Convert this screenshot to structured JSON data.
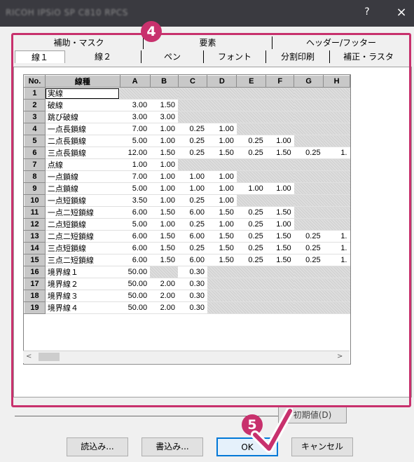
{
  "window": {
    "title": "RICOH IPSiO SP C810 RPCS",
    "help": "?",
    "close": "×"
  },
  "tabs_top": [
    {
      "label": "補助・マスク"
    },
    {
      "label": "要素"
    },
    {
      "label": "ヘッダー/フッター"
    }
  ],
  "tabs_bottom": [
    {
      "label": "線１"
    },
    {
      "label": "線２"
    },
    {
      "label": "ペン"
    },
    {
      "label": "フォント"
    },
    {
      "label": "分割印刷"
    },
    {
      "label": "補正・ラスタ"
    }
  ],
  "table": {
    "columns": [
      "No.",
      "線種",
      "A",
      "B",
      "C",
      "D",
      "E",
      "F",
      "G",
      "H"
    ],
    "rows": [
      {
        "no": "1",
        "name": "実線",
        "v": [
          "",
          "",
          "",
          "",
          "",
          "",
          "",
          ""
        ]
      },
      {
        "no": "2",
        "name": "破線",
        "v": [
          "3.00",
          "1.50",
          "",
          "",
          "",
          "",
          "",
          ""
        ]
      },
      {
        "no": "3",
        "name": "跳び破線",
        "v": [
          "3.00",
          "3.00",
          "",
          "",
          "",
          "",
          "",
          ""
        ]
      },
      {
        "no": "4",
        "name": "一点長鎖線",
        "v": [
          "7.00",
          "1.00",
          "0.25",
          "1.00",
          "",
          "",
          "",
          ""
        ]
      },
      {
        "no": "5",
        "name": "二点長鎖線",
        "v": [
          "5.00",
          "1.00",
          "0.25",
          "1.00",
          "0.25",
          "1.00",
          "",
          ""
        ]
      },
      {
        "no": "6",
        "name": "三点長鎖線",
        "v": [
          "12.00",
          "1.50",
          "0.25",
          "1.50",
          "0.25",
          "1.50",
          "0.25",
          "1."
        ]
      },
      {
        "no": "7",
        "name": "点線",
        "v": [
          "1.00",
          "1.00",
          "",
          "",
          "",
          "",
          "",
          ""
        ]
      },
      {
        "no": "8",
        "name": "一点鎖線",
        "v": [
          "7.00",
          "1.00",
          "1.00",
          "1.00",
          "",
          "",
          "",
          ""
        ]
      },
      {
        "no": "9",
        "name": "二点鎖線",
        "v": [
          "5.00",
          "1.00",
          "1.00",
          "1.00",
          "1.00",
          "1.00",
          "",
          ""
        ]
      },
      {
        "no": "10",
        "name": "一点短鎖線",
        "v": [
          "3.50",
          "1.00",
          "0.25",
          "1.00",
          "",
          "",
          "",
          ""
        ]
      },
      {
        "no": "11",
        "name": "一点二短鎖線",
        "v": [
          "6.00",
          "1.50",
          "6.00",
          "1.50",
          "0.25",
          "1.50",
          "",
          ""
        ]
      },
      {
        "no": "12",
        "name": "二点短鎖線",
        "v": [
          "5.00",
          "1.00",
          "0.25",
          "1.00",
          "0.25",
          "1.00",
          "",
          ""
        ]
      },
      {
        "no": "13",
        "name": "二点二短鎖線",
        "v": [
          "6.00",
          "1.50",
          "6.00",
          "1.50",
          "0.25",
          "1.50",
          "0.25",
          "1."
        ]
      },
      {
        "no": "14",
        "name": "三点短鎖線",
        "v": [
          "6.00",
          "1.50",
          "0.25",
          "1.50",
          "0.25",
          "1.50",
          "0.25",
          "1."
        ]
      },
      {
        "no": "15",
        "name": "三点二短鎖線",
        "v": [
          "6.00",
          "1.50",
          "6.00",
          "1.50",
          "0.25",
          "1.50",
          "0.25",
          "1."
        ]
      },
      {
        "no": "16",
        "name": "境界線１",
        "v": [
          "50.00",
          "",
          "0.30",
          "",
          "",
          "",
          "",
          ""
        ]
      },
      {
        "no": "17",
        "name": "境界線２",
        "v": [
          "50.00",
          "2.00",
          "0.30",
          "",
          "",
          "",
          "",
          ""
        ]
      },
      {
        "no": "18",
        "name": "境界線３",
        "v": [
          "50.00",
          "2.00",
          "0.30",
          "",
          "",
          "",
          "",
          ""
        ]
      },
      {
        "no": "19",
        "name": "境界線４",
        "v": [
          "50.00",
          "2.00",
          "0.30",
          "",
          "",
          "",
          "",
          ""
        ]
      }
    ]
  },
  "scroll": {
    "left": "<",
    "right": ">"
  },
  "hidden_button": "初期値(D)",
  "buttons": {
    "load": "読込み...",
    "save": "書込み...",
    "ok": "OK",
    "cancel": "キャンセル"
  },
  "annotations": {
    "step4": "4",
    "step5": "5",
    "color": "#c8316d"
  }
}
